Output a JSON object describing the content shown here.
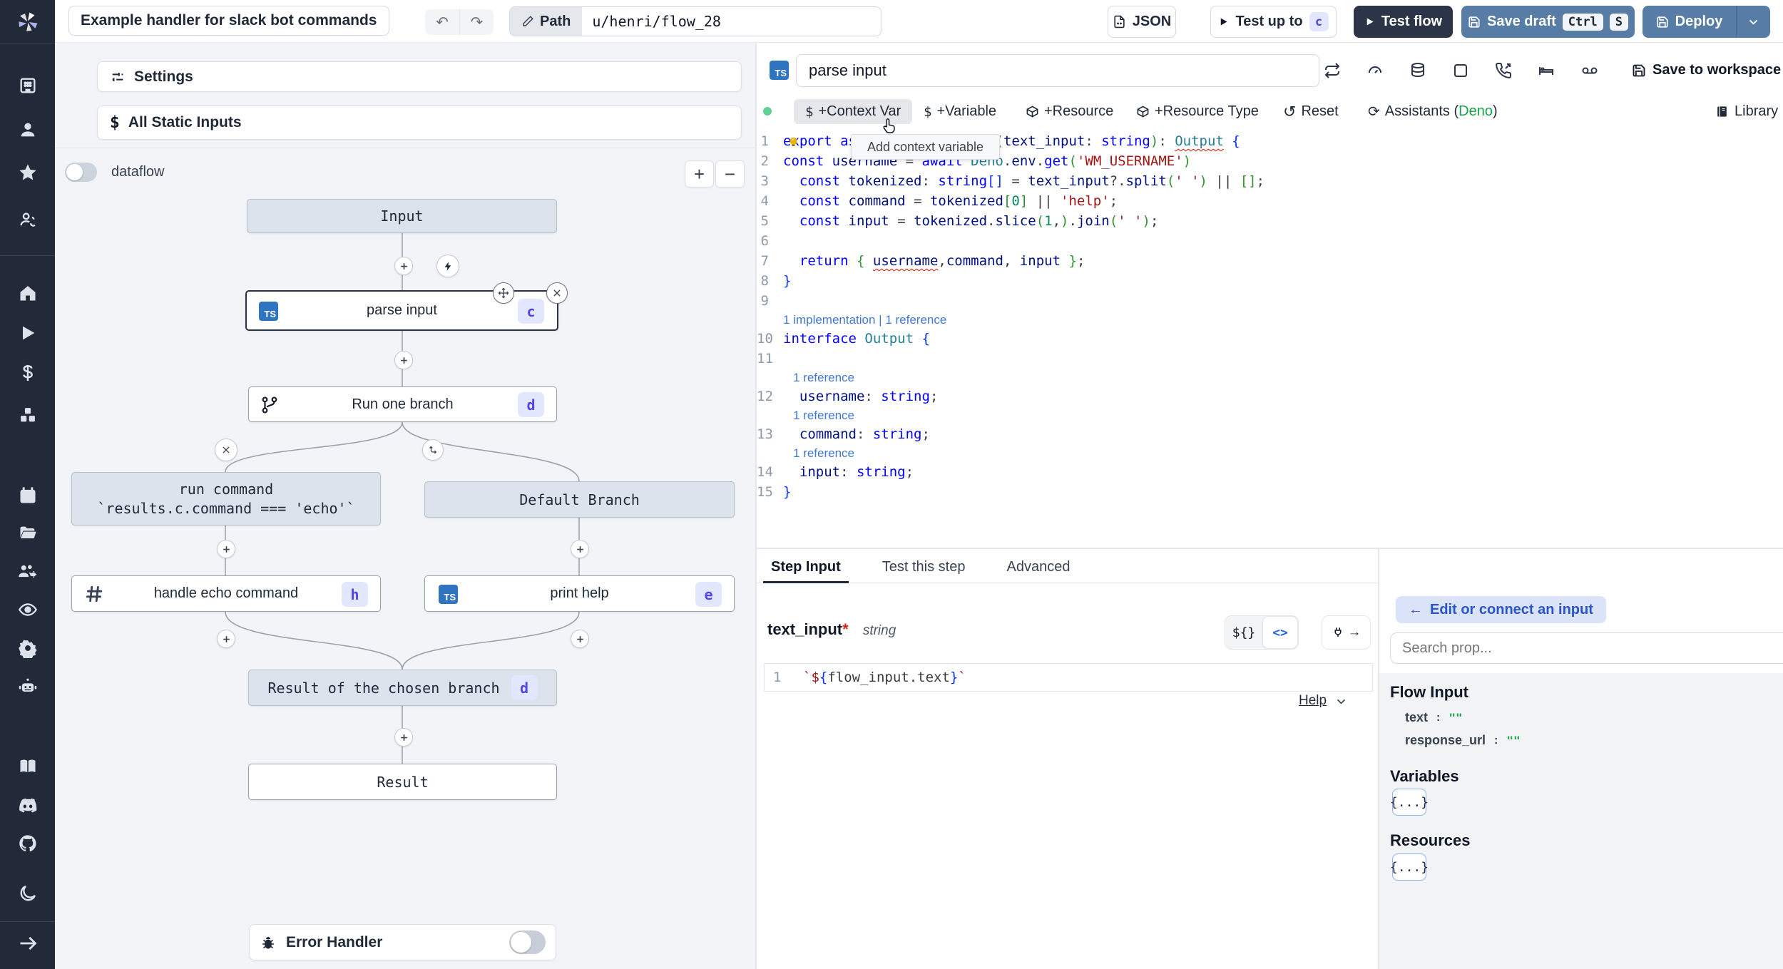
{
  "topbar": {
    "title": "Example handler for slack bot commands",
    "path_label": "Path",
    "path_value": "u/henri/flow_28",
    "json_label": "JSON",
    "test_up_to_label": "Test up to",
    "test_up_to_badge": "c",
    "test_flow_label": "Test flow",
    "save_draft_label": "Save draft",
    "kbd": [
      "Ctrl",
      "S"
    ],
    "deploy_label": "Deploy",
    "colors": {
      "steel_button": "#577ca6",
      "dark_button": "#2b3547",
      "sidebar": "#222938"
    }
  },
  "sidebar": {
    "icons": [
      "windmill-logo",
      "workspace",
      "user",
      "favorites",
      "switch-user",
      "home",
      "runs",
      "variables",
      "resources",
      "schedules",
      "folders",
      "groups",
      "audit-logs",
      "settings",
      "ai",
      "docs",
      "discord",
      "github",
      "dark-mode",
      "expand"
    ]
  },
  "flow_panel": {
    "settings_label": "Settings",
    "static_inputs_label": "All Static Inputs",
    "dataflow_label": "dataflow",
    "zoom_in": "+",
    "zoom_out": "−",
    "nodes": {
      "input": "Input",
      "parse": {
        "title": "parse input",
        "badge": "c",
        "lang": "TS"
      },
      "branch": {
        "title": "Run one branch",
        "badge": "d"
      },
      "run_cmd": {
        "line1": "run command",
        "line2": "`results.c.command === 'echo'`"
      },
      "default_branch": "Default Branch",
      "echo": {
        "title": "handle echo command",
        "badge": "h"
      },
      "help": {
        "title": "print help",
        "badge": "e",
        "lang": "TS"
      },
      "chosen": {
        "title": "Result of the chosen branch",
        "badge": "d"
      },
      "result": "Result"
    },
    "error_handler_label": "Error Handler"
  },
  "editor": {
    "step_name": "parse input",
    "header_icons": [
      "repeat",
      "gauge",
      "database",
      "square",
      "phone-incoming",
      "bed",
      "voicemail"
    ],
    "save_to_workspace": "Save to workspace",
    "toolbar": {
      "context_var": "+Context Var",
      "variable": "+Variable",
      "resource": "+Resource",
      "resource_type": "+Resource Type",
      "reset": "Reset",
      "assistants_prefix": "Assistants (",
      "assistants_lang": "Deno",
      "assistants_suffix": ")",
      "library": "Library"
    },
    "tooltip": "Add context variable",
    "code": {
      "language_badge": "TS",
      "rows": [
        {
          "n": "1",
          "seg": [
            [
              "export",
              "kw"
            ],
            [
              " ",
              "pl"
            ],
            [
              "async",
              "kw"
            ],
            [
              " ",
              "pl"
            ],
            [
              "function",
              "kw"
            ],
            [
              " ",
              "pl"
            ],
            [
              "main",
              "fn"
            ],
            [
              "(",
              "brk"
            ],
            [
              "text_input",
              "id"
            ],
            [
              ": ",
              "pl"
            ],
            [
              "string",
              "kw"
            ],
            [
              ")",
              "brk"
            ],
            [
              ": ",
              "pl"
            ],
            [
              "Output",
              "type sq"
            ],
            [
              " ",
              "pl"
            ],
            [
              "{",
              "brc"
            ]
          ]
        },
        {
          "n": "2",
          "seg": [
            [
              "const",
              "kw"
            ],
            [
              " ",
              "pl"
            ],
            [
              "username",
              "id"
            ],
            [
              " = ",
              "pl"
            ],
            [
              "await",
              "kw"
            ],
            [
              " ",
              "pl"
            ],
            [
              "Deno",
              "type"
            ],
            [
              ".",
              "pl"
            ],
            [
              "env",
              "id"
            ],
            [
              ".",
              "pl"
            ],
            [
              "get",
              "kw"
            ],
            [
              "(",
              "brk"
            ],
            [
              "'WM_USERNAME'",
              "str"
            ],
            [
              ")",
              "brk"
            ]
          ],
          "bulb": true
        },
        {
          "n": "3",
          "seg": [
            [
              "  ",
              "pl"
            ],
            [
              "const",
              "kw"
            ],
            [
              " ",
              "pl"
            ],
            [
              "tokenized",
              "id"
            ],
            [
              ": ",
              "pl"
            ],
            [
              "string",
              "kw"
            ],
            [
              "[]",
              "brc"
            ],
            [
              " = ",
              "pl"
            ],
            [
              "text_input",
              "id"
            ],
            [
              "?.",
              "pl"
            ],
            [
              "split",
              "id"
            ],
            [
              "(",
              "brk"
            ],
            [
              "' '",
              "str"
            ],
            [
              ")",
              "brk"
            ],
            [
              " || ",
              "pl"
            ],
            [
              "[]",
              "brk"
            ],
            [
              ";",
              "pl"
            ]
          ]
        },
        {
          "n": "4",
          "seg": [
            [
              "  ",
              "pl"
            ],
            [
              "const",
              "kw"
            ],
            [
              " ",
              "pl"
            ],
            [
              "command",
              "id"
            ],
            [
              " = ",
              "pl"
            ],
            [
              "tokenized",
              "id"
            ],
            [
              "[",
              "brk"
            ],
            [
              "0",
              "num"
            ],
            [
              "]",
              "brk"
            ],
            [
              " || ",
              "pl"
            ],
            [
              "'help'",
              "str"
            ],
            [
              ";",
              "pl"
            ]
          ]
        },
        {
          "n": "5",
          "seg": [
            [
              "  ",
              "pl"
            ],
            [
              "const",
              "kw"
            ],
            [
              " ",
              "pl"
            ],
            [
              "input",
              "id"
            ],
            [
              " = ",
              "pl"
            ],
            [
              "tokenized",
              "id"
            ],
            [
              ".",
              "pl"
            ],
            [
              "slice",
              "id"
            ],
            [
              "(",
              "brk"
            ],
            [
              "1",
              "num"
            ],
            [
              ",",
              "pl"
            ],
            [
              ")",
              "brk"
            ],
            [
              ".",
              "pl"
            ],
            [
              "join",
              "id"
            ],
            [
              "(",
              "brk"
            ],
            [
              "' '",
              "str"
            ],
            [
              ")",
              "brk"
            ],
            [
              ";",
              "pl"
            ]
          ]
        },
        {
          "n": "6",
          "seg": []
        },
        {
          "n": "7",
          "seg": [
            [
              "  ",
              "pl"
            ],
            [
              "return",
              "kw"
            ],
            [
              " ",
              "pl"
            ],
            [
              "{",
              "brk"
            ],
            [
              " ",
              "pl"
            ],
            [
              "username",
              "id sq"
            ],
            [
              ",",
              "pl"
            ],
            [
              "command",
              "id"
            ],
            [
              ", ",
              "pl"
            ],
            [
              "input",
              "id"
            ],
            [
              " ",
              "pl"
            ],
            [
              "}",
              "brk"
            ],
            [
              ";",
              "pl"
            ]
          ]
        },
        {
          "n": "8",
          "seg": [
            [
              "}",
              "brc"
            ]
          ]
        },
        {
          "n": "9",
          "seg": []
        },
        {
          "lens": "1 implementation | 1 reference"
        },
        {
          "n": "10",
          "seg": [
            [
              "interface",
              "kw"
            ],
            [
              " ",
              "pl"
            ],
            [
              "Output",
              "type"
            ],
            [
              " ",
              "pl"
            ],
            [
              "{",
              "brc"
            ]
          ]
        },
        {
          "n": "11",
          "seg": []
        },
        {
          "lens": "1 reference",
          "indent": 1
        },
        {
          "n": "12",
          "seg": [
            [
              "  ",
              "pl"
            ],
            [
              "username",
              "id"
            ],
            [
              ": ",
              "pl"
            ],
            [
              "string",
              "kw"
            ],
            [
              ";",
              "pl"
            ]
          ]
        },
        {
          "lens": "1 reference",
          "indent": 1
        },
        {
          "n": "13",
          "seg": [
            [
              "  ",
              "pl"
            ],
            [
              "command",
              "id"
            ],
            [
              ": ",
              "pl"
            ],
            [
              "string",
              "kw"
            ],
            [
              ";",
              "pl"
            ]
          ]
        },
        {
          "lens": "1 reference",
          "indent": 1
        },
        {
          "n": "14",
          "seg": [
            [
              "  ",
              "pl"
            ],
            [
              "input",
              "id"
            ],
            [
              ": ",
              "pl"
            ],
            [
              "string",
              "kw"
            ],
            [
              ";",
              "pl"
            ]
          ]
        },
        {
          "n": "15",
          "seg": [
            [
              "}",
              "brc"
            ]
          ]
        }
      ]
    }
  },
  "step_panel": {
    "tabs": [
      "Step Input",
      "Test this step",
      "Advanced"
    ],
    "field_name": "text_input",
    "required_marker": "*",
    "field_type": "string",
    "toggle_json": "${}",
    "toggle_code": "<>",
    "editor_line_no": "1",
    "editor_value": "`${flow_input.text}`",
    "editor_segments": [
      [
        "`$",
        "str"
      ],
      [
        "{",
        "brc"
      ],
      [
        "flow_input.text",
        "pl"
      ],
      [
        "}",
        "brc"
      ],
      [
        "`",
        "str"
      ]
    ],
    "help_label": "Help"
  },
  "right_panel": {
    "connect_button": "Edit or connect an input",
    "search_placeholder": "Search prop...",
    "flow_input_title": "Flow Input",
    "props": [
      {
        "key": "text",
        "sep": ":",
        "value": "\"\""
      },
      {
        "key": "response_url",
        "sep": ":",
        "value": "\"\""
      }
    ],
    "variables_title": "Variables",
    "resources_title": "Resources",
    "object_chip": "{...}",
    "colors": {
      "connect_bg": "#dbe3f8",
      "connect_text": "#2a55c9"
    }
  }
}
